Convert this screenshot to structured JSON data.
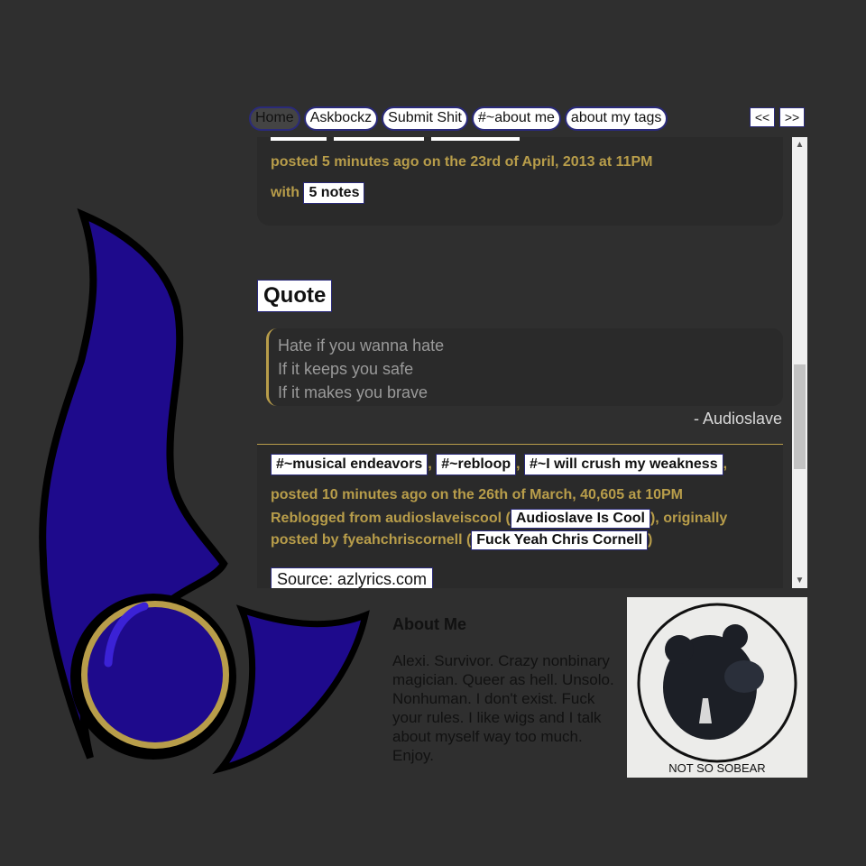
{
  "nav": {
    "items": [
      "Home",
      "Askbockz",
      "Submit Shit",
      "#~about me",
      "about my tags"
    ],
    "prev_label": "<<",
    "next_label": ">>"
  },
  "post1": {
    "date_text": "posted 5 minutes ago on the 23rd of April, 2013 at 11PM",
    "notes_prefix": "with",
    "notes_label": "5 notes"
  },
  "post2": {
    "type_label": "Quote",
    "quote_lines": [
      "Hate if you wanna hate",
      "If it keeps you safe",
      "If it makes you brave"
    ],
    "source": "- Audioslave",
    "tags": [
      "#~musical endeavors",
      "#~rebloop",
      "#~I will crush my weakness"
    ],
    "date_text": "posted 10 minutes ago on the 26th of March, 40,605 at 10PM",
    "reblog_prefix": "Reblogged from audioslaveiscool (",
    "reblog_link": "Audioslave Is Cool",
    "reblog_middle": "), originally posted by fyeahchriscornell (",
    "origin_link": "Fuck Yeah Chris Cornell",
    "reblog_suffix": ")",
    "source_label": "Source: azlyrics.com"
  },
  "about": {
    "title": "About Me",
    "text": "Alexi. Survivor. Crazy nonbinary magician. Queer as hell. Unsolo. Nonhuman. I don't exist. Fuck your rules. I like wigs and I talk about myself way too much. Enjoy.",
    "image_caption": "NOT SO SOBEAR"
  },
  "colors": {
    "background": "#2f2f2f",
    "accent_gold": "#b89d4a",
    "logo_blue": "#1e0a8c"
  }
}
